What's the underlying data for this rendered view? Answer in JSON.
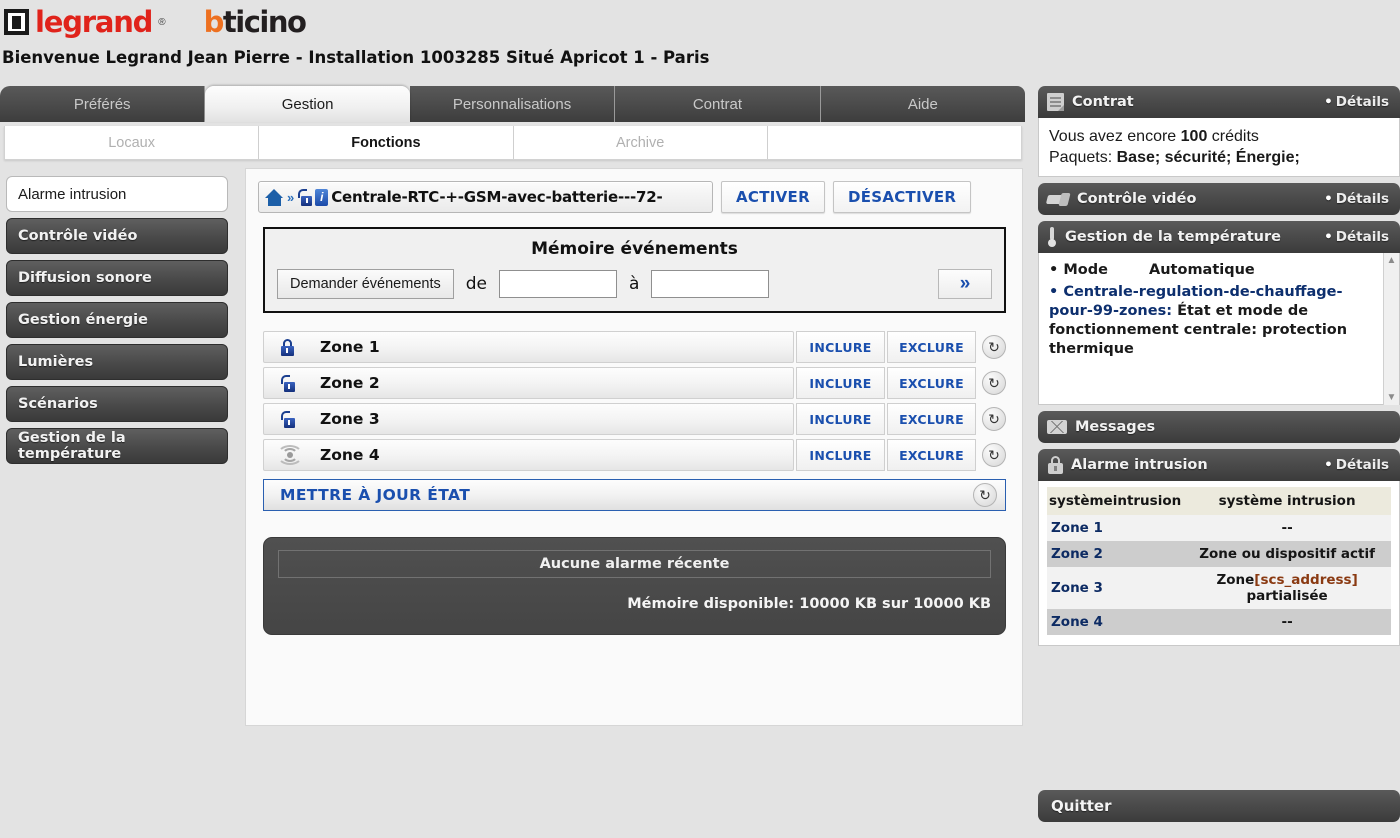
{
  "brand": {
    "legrand": "legrand",
    "legrand_reg": "®",
    "bticino_b": "b",
    "bticino_rest": "ticino"
  },
  "welcome": "Bienvenue Legrand Jean Pierre - Installation 1003285 Situé Apricot 1 - Paris",
  "tabs": [
    {
      "label": "Préférés",
      "active": false
    },
    {
      "label": "Gestion",
      "active": true
    },
    {
      "label": "Personnalisations",
      "active": false
    },
    {
      "label": "Contrat",
      "active": false
    },
    {
      "label": "Aide",
      "active": false
    }
  ],
  "subtabs": [
    {
      "label": "Locaux",
      "active": false
    },
    {
      "label": "Fonctions",
      "active": true
    },
    {
      "label": "Archive",
      "active": false
    },
    {
      "label": "",
      "active": false
    }
  ],
  "sidebar": {
    "items": [
      {
        "label": "Alarme intrusion",
        "active": true
      },
      {
        "label": "Contrôle vidéo",
        "active": false
      },
      {
        "label": "Diffusion sonore",
        "active": false
      },
      {
        "label": "Gestion énergie",
        "active": false
      },
      {
        "label": "Lumières",
        "active": false
      },
      {
        "label": "Scénarios",
        "active": false
      },
      {
        "label": "Gestion de la température",
        "active": false
      }
    ]
  },
  "device": {
    "name": "Centrale-RTC-+-GSM-avec-batterie---72-",
    "activate_label": "ACTIVER",
    "deactivate_label": "DÉSACTIVER"
  },
  "memory": {
    "title": "Mémoire événements",
    "request_button": "Demander événements",
    "from_label": "de",
    "to_label": "à",
    "from_value": "",
    "to_value": "",
    "from_placeholder": "",
    "to_placeholder": "",
    "go_label": "»"
  },
  "zones": {
    "include_label": "INCLURE",
    "exclude_label": "EXCLURE",
    "rows": [
      {
        "name": "Zone 1",
        "icon": "lock-closed-icon"
      },
      {
        "name": "Zone 2",
        "icon": "lock-open-icon"
      },
      {
        "name": "Zone 3",
        "icon": "lock-open-icon"
      },
      {
        "name": "Zone 4",
        "icon": "signal-wave-icon"
      }
    ],
    "update_label": "METTRE À JOUR ÉTAT"
  },
  "alarm_box": {
    "status": "Aucune alarme récente",
    "memory": "Mémoire disponible: 10000 KB sur 10000 KB"
  },
  "right": {
    "contract": {
      "title": "Contrat",
      "details": "Détails",
      "credits_pre": "Vous avez encore ",
      "credits_value": "100",
      "credits_post": " crédits",
      "packages_label": "Paquets: ",
      "packages_value": "Base; sécurité; Énergie;"
    },
    "video": {
      "title": "Contrôle vidéo",
      "details": "Détails"
    },
    "temperature": {
      "title": "Gestion de la température",
      "details": "Détails",
      "mode_key": "• Mode",
      "mode_value": "Automatique",
      "entry_prefix": "• Centrale-regulation-de-chauffage-pour-99-zones:",
      "entry_text": " État et mode de fonctionnement centrale: protection thermique"
    },
    "messages": {
      "title": "Messages"
    },
    "intrusion": {
      "title": "Alarme intrusion",
      "details": "Détails",
      "columns": [
        "systèmeintrusion",
        "système intrusion"
      ],
      "rows": [
        {
          "zone": "Zone 1",
          "value": "--",
          "has_scs": false
        },
        {
          "zone": "Zone 2",
          "value": "Zone ou dispositif actif",
          "has_scs": false
        },
        {
          "zone": "Zone 3",
          "value_pre": "Zone",
          "value_scs": "[scs_address]",
          "value_post": "partialisée",
          "has_scs": true
        },
        {
          "zone": "Zone 4",
          "value": "--",
          "has_scs": false
        }
      ]
    },
    "quit_label": "Quitter"
  },
  "colors": {
    "accent_blue": "#1a4fae",
    "legrand_red": "#e0231b",
    "bticino_orange": "#ed7020",
    "panel_dark": "#4a4a4a"
  }
}
